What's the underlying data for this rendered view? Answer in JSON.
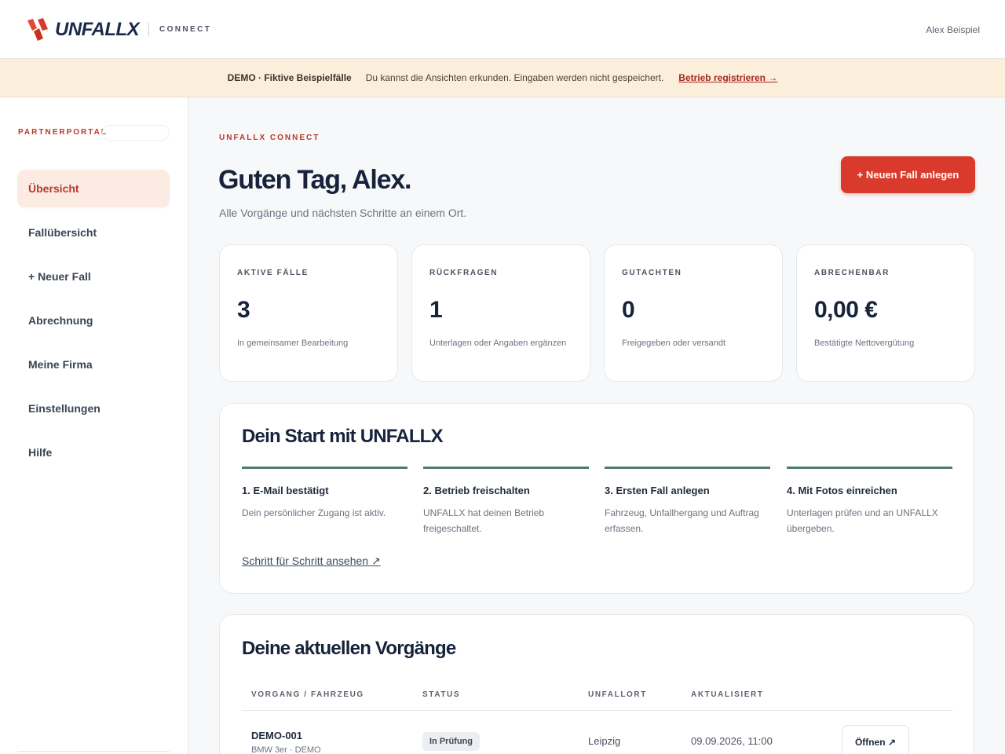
{
  "header": {
    "brand": "UNFALLX",
    "product": "CONNECT",
    "user_name": "Alex Beispiel",
    "brand_color": "#d93a2b"
  },
  "banner": {
    "label": "DEMO · Fiktive Beispielfälle",
    "text": "Du kannst die Ansichten erkunden. Eingaben werden nicht gespeichert.",
    "link": "Betrieb registrieren →"
  },
  "sidebar": {
    "section_label": "PARTNERPORTAL",
    "items": [
      {
        "label": "Übersicht",
        "active": true
      },
      {
        "label": "Fallübersicht"
      },
      {
        "label": "+ Neuer Fall"
      },
      {
        "label": "Abrechnung"
      },
      {
        "label": "Meine Firma"
      },
      {
        "label": "Einstellungen"
      },
      {
        "label": "Hilfe"
      }
    ]
  },
  "main": {
    "eyebrow": "UNFALLX CONNECT",
    "greeting": "Guten Tag, Alex.",
    "subtitle": "Alle Vorgänge und nächsten Schritte an einem Ort.",
    "new_case_button": "+ Neuen Fall anlegen",
    "stats": [
      {
        "title": "AKTIVE FÄLLE",
        "value": "3",
        "desc": "In gemeinsamer Bearbeitung"
      },
      {
        "title": "RÜCKFRAGEN",
        "value": "1",
        "desc": "Unterlagen oder Angaben ergänzen"
      },
      {
        "title": "GUTACHTEN",
        "value": "0",
        "desc": "Freigegeben oder versandt"
      },
      {
        "title": "ABRECHENBAR",
        "value": "0,00 €",
        "desc": "Bestätigte Nettovergütung"
      }
    ],
    "onboarding": {
      "title": "Dein Start mit UNFALLX",
      "steps": [
        {
          "title": "1. E-Mail bestätigt",
          "desc": "Dein persönlicher Zugang ist aktiv."
        },
        {
          "title": "2. Betrieb freischalten",
          "desc": "UNFALLX hat deinen Betrieb freigeschaltet."
        },
        {
          "title": "3. Ersten Fall anlegen",
          "desc": "Fahrzeug, Unfallhergang und Auftrag erfassen."
        },
        {
          "title": "4. Mit Fotos einreichen",
          "desc": "Unterlagen prüfen und an UNFALLX übergeben."
        }
      ],
      "link": "Schritt für Schritt ansehen ↗"
    },
    "cases": {
      "title": "Deine aktuellen Vorgänge",
      "columns": [
        "VORGANG / FAHRZEUG",
        "STATUS",
        "UNFALLORT",
        "AKTUALISIERT"
      ],
      "rows": [
        {
          "id": "DEMO-001",
          "vehicle": "BMW 3er · DEMO",
          "status": "In Prüfung",
          "place": "Leipzig",
          "updated": "09.09.2026, 11:00",
          "action": "Öffnen ↗"
        }
      ]
    }
  }
}
